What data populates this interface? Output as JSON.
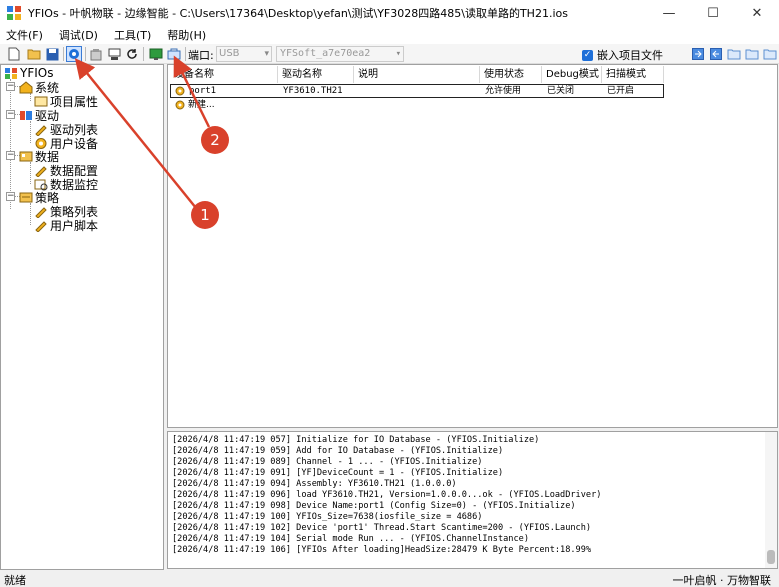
{
  "window": {
    "title": "YFIOs - 叶帆物联 - 边缘智能 - C:\\Users\\17364\\Desktop\\yefan\\测试\\YF3028四路485\\读取单路的TH21.ios",
    "minimize": "—",
    "maximize": "☐",
    "close": "✕"
  },
  "menu": [
    "文件(F)",
    "调试(D)",
    "工具(T)",
    "帮助(H)"
  ],
  "toolbar": {
    "port_label": "端口:",
    "port_value": "USB",
    "device_value": "YFSoft_a7e70ea2",
    "embed_label": "嵌入项目文件"
  },
  "tree": {
    "root": "YFIOs",
    "system": "系统",
    "project_props": "项目属性",
    "driver": "驱动",
    "driver_list": "驱动列表",
    "user_device": "用户设备",
    "data": "数据",
    "data_config": "数据配置",
    "data_monitor": "数据监控",
    "strategy": "策略",
    "strategy_list": "策略列表",
    "user_script": "用户脚本"
  },
  "grid": {
    "headers": [
      "设备名称",
      "驱动名称",
      "说明",
      "使用状态",
      "Debug模式",
      "扫描模式"
    ],
    "rows": [
      [
        "port1",
        "YF3610.TH21",
        "",
        "允许使用",
        "已关闭",
        "已开启"
      ],
      [
        "新建...",
        "",
        "",
        "",
        "",
        ""
      ]
    ]
  },
  "log": [
    "[2026/4/8 11:47:19 057] Initialize for IO Database - (YFIOS.Initialize)",
    "[2026/4/8 11:47:19 059] Add for IO Database - (YFIOS.Initialize)",
    "[2026/4/8 11:47:19 089] Channel - 1 ... - (YFIOS.Initialize)",
    "[2026/4/8 11:47:19 091] [YF]DeviceCount = 1 - (YFIOS.Initialize)",
    "[2026/4/8 11:47:19 094] Assembly: YF3610.TH21 (1.0.0.0)",
    "[2026/4/8 11:47:19 096] load YF3610.TH21, Version=1.0.0.0...ok - (YFIOS.LoadDriver)",
    "[2026/4/8 11:47:19 098] Device Name:port1 (Config Size=0) - (YFIOS.Initialize)",
    "[2026/4/8 11:47:19 100] YFIOs_Size=7638(iosfile_size = 4686)",
    "[2026/4/8 11:47:19 102] Device 'port1' Thread.Start Scantime=200 - (YFIOS.Launch)",
    "[2026/4/8 11:47:19 104] Serial mode Run ... - (YFIOS.ChannelInstance)",
    "[2026/4/8 11:47:19 106] [YFIOs After loading]HeadSize:28479 K Byte Percent:18.99%"
  ],
  "status": {
    "left": "就绪",
    "right": "一叶启帆 · 万物智联"
  },
  "annotations": [
    "1",
    "2"
  ],
  "colors": {
    "marker": "#d9412b",
    "checkbox": "#1e6fd8"
  }
}
